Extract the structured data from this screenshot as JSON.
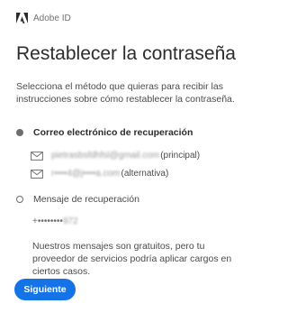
{
  "header": {
    "brand": "Adobe ID",
    "logo_icon": "adobe-logo-icon",
    "logo_color": "#2c2c2c"
  },
  "title": "Restablecer la contraseña",
  "description": "Selecciona el método que quieras para recibir las instrucciones sobre cómo restablecer la contraseña.",
  "options": {
    "email": {
      "label": "Correo electrónico de recuperación",
      "selected": true,
      "addresses": [
        {
          "address": "pietrasbsfdhfsl@gmail.com",
          "tag": "(principal)",
          "icon": "mail-icon"
        },
        {
          "address": "r••••4@j••••a.com",
          "tag": "(alternativa)",
          "icon": "mail-icon"
        }
      ]
    },
    "sms": {
      "label": "Mensaje de recuperación",
      "selected": false,
      "phone_prefix": "+••••••••",
      "phone_suffix": "972"
    }
  },
  "note": "Nuestros mensajes son gratuitos, pero tu proveedor de servicios podría aplicar cargos en ciertos casos.",
  "button": {
    "label": "Siguiente",
    "color": "#1473e6"
  }
}
